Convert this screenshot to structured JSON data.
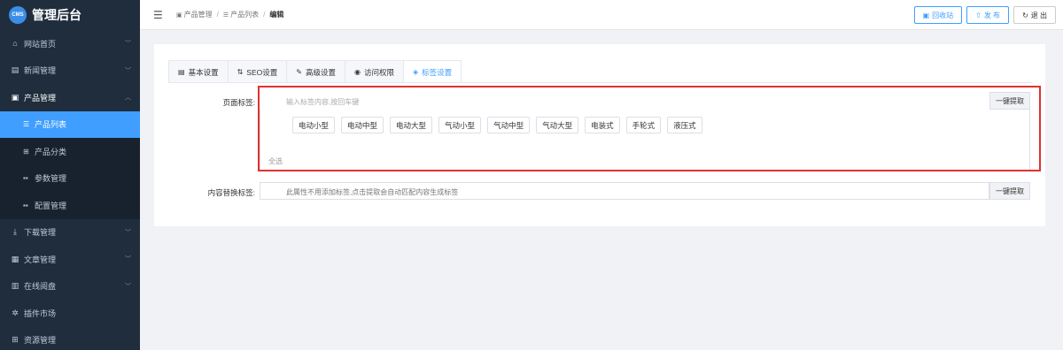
{
  "app": {
    "logo_badge": "CMS",
    "title": "管理后台"
  },
  "sidebar": {
    "items": [
      {
        "label": "网站首页",
        "icon": "home-icon",
        "glyph": "⌂",
        "expandable": true
      },
      {
        "label": "新闻管理",
        "icon": "newspaper-icon",
        "glyph": "▤",
        "expandable": true
      },
      {
        "label": "产品管理",
        "icon": "document-icon",
        "glyph": "🗎",
        "expandable": true,
        "open": true
      },
      {
        "label": "下载管理",
        "icon": "download-icon",
        "glyph": "⤓",
        "expandable": true
      },
      {
        "label": "文章管理",
        "icon": "article-icon",
        "glyph": "▦",
        "expandable": true
      },
      {
        "label": "在线阅盘",
        "icon": "grid-icon",
        "glyph": "▥",
        "expandable": true
      },
      {
        "label": "插件市场",
        "icon": "pin-icon",
        "glyph": "✲",
        "expandable": false
      },
      {
        "label": "资源管理",
        "icon": "resource-icon",
        "glyph": "⊞",
        "expandable": false
      }
    ],
    "sub_items": [
      {
        "label": "产品列表",
        "icon": "list-icon",
        "glyph": "☰",
        "active": true
      },
      {
        "label": "产品分类",
        "icon": "category-icon",
        "glyph": "⊞"
      },
      {
        "label": "参数管理",
        "icon": "params-icon",
        "glyph": "▪▪"
      },
      {
        "label": "配置管理",
        "icon": "config-icon",
        "glyph": "▪▪"
      }
    ]
  },
  "header": {
    "breadcrumb": [
      "产品管理",
      "产品列表",
      "编辑"
    ],
    "buttons": {
      "recycle": "回收站",
      "publish": "发 布",
      "logout": "退 出"
    }
  },
  "tabs": [
    {
      "label": "基本设置",
      "icon": "file-icon",
      "glyph": "▤"
    },
    {
      "label": "SEO设置",
      "icon": "seo-icon",
      "glyph": "⇅"
    },
    {
      "label": "高级设置",
      "icon": "pen-icon",
      "glyph": "✎"
    },
    {
      "label": "访问权限",
      "icon": "eye-icon",
      "glyph": "◉"
    },
    {
      "label": "标签设置",
      "icon": "tag-icon",
      "glyph": "◈",
      "active": true
    }
  ],
  "form": {
    "page_tags": {
      "label": "页面标签:",
      "placeholder": "输入标签内容,按回车键",
      "extract_button": "一键提取",
      "tags": [
        "电动小型",
        "电动中型",
        "电动大型",
        "气动小型",
        "气动中型",
        "气动大型",
        "电装式",
        "手轮式",
        "液压式"
      ],
      "select_all": "全选"
    },
    "replace_tags": {
      "label": "内容替换标签:",
      "placeholder": "此属性不用添加标签,点击提取会自动匹配内容生成标签",
      "extract_button": "一键提取"
    }
  },
  "colors": {
    "accent": "#409eff",
    "sidebar_bg": "#1f2d3d",
    "highlight": "#e03131"
  }
}
